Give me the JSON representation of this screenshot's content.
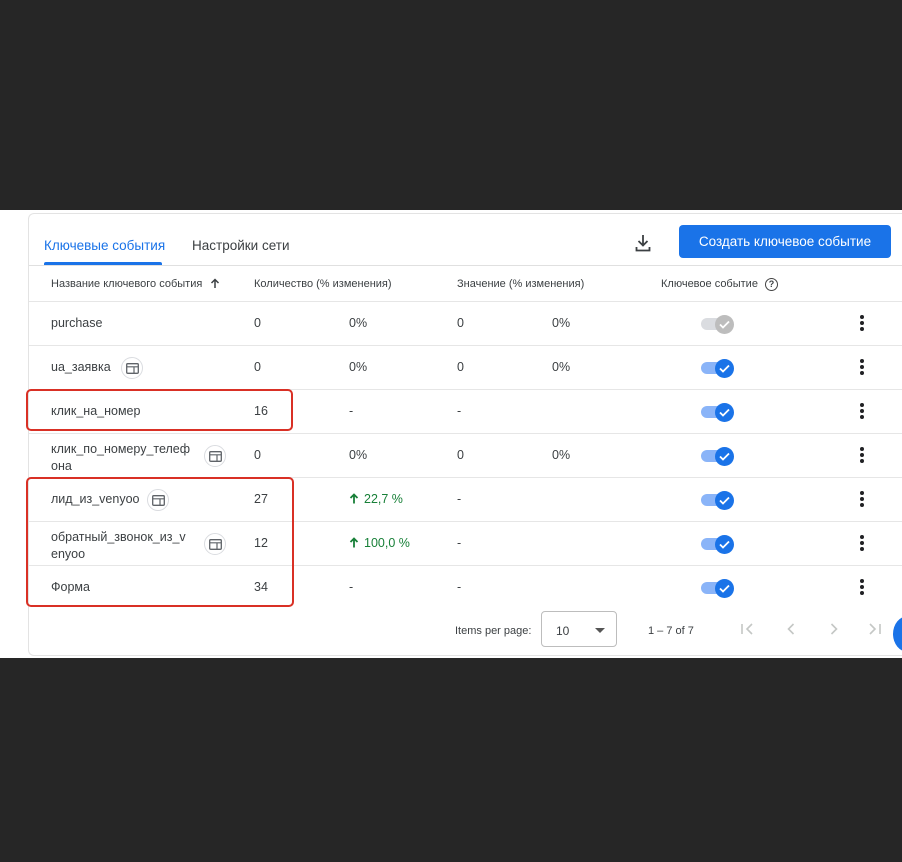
{
  "tabs": {
    "key_events": "Ключевые события",
    "network_settings": "Настройки сети"
  },
  "actions": {
    "download_icon": "download-icon",
    "create_button": "Создать ключевое событие"
  },
  "columns": {
    "name": "Название ключевого события",
    "count": "Количество (% изменения)",
    "value": "Значение (% изменения)",
    "key_event": "Ключевое событие"
  },
  "rows": [
    {
      "name": "purchase",
      "count": "0",
      "count_change": "0%",
      "value": "0",
      "value_change": "0%",
      "enabled": false
    },
    {
      "name": "ua_заявка",
      "count": "0",
      "count_change": "0%",
      "value": "0",
      "value_change": "0%",
      "enabled": true
    },
    {
      "name": "клик_на_номер",
      "count": "16",
      "count_change": "-",
      "value": "-",
      "value_change": "",
      "enabled": true
    },
    {
      "name": "клик_по_номеру_телеф она",
      "count": "0",
      "count_change": "0%",
      "value": "0",
      "value_change": "0%",
      "enabled": true
    },
    {
      "name": "лид_из_venyoo",
      "count": "27",
      "count_change": "22,7 %",
      "value": "-",
      "value_change": "",
      "enabled": true
    },
    {
      "name": "обратный_звонок_из_v enyoo",
      "count": "12",
      "count_change": "100,0 %",
      "value": "-",
      "value_change": "",
      "enabled": true
    },
    {
      "name": "Форма",
      "count": "34",
      "count_change": "-",
      "value": "-",
      "value_change": "",
      "enabled": true
    }
  ],
  "pagination": {
    "items_per_page_label": "Items per page:",
    "items_per_page_value": "10",
    "range_text": "1 – 7 of 7"
  },
  "colors": {
    "accent": "#1a73e8",
    "positive": "#188038",
    "highlight": "#d93025"
  }
}
